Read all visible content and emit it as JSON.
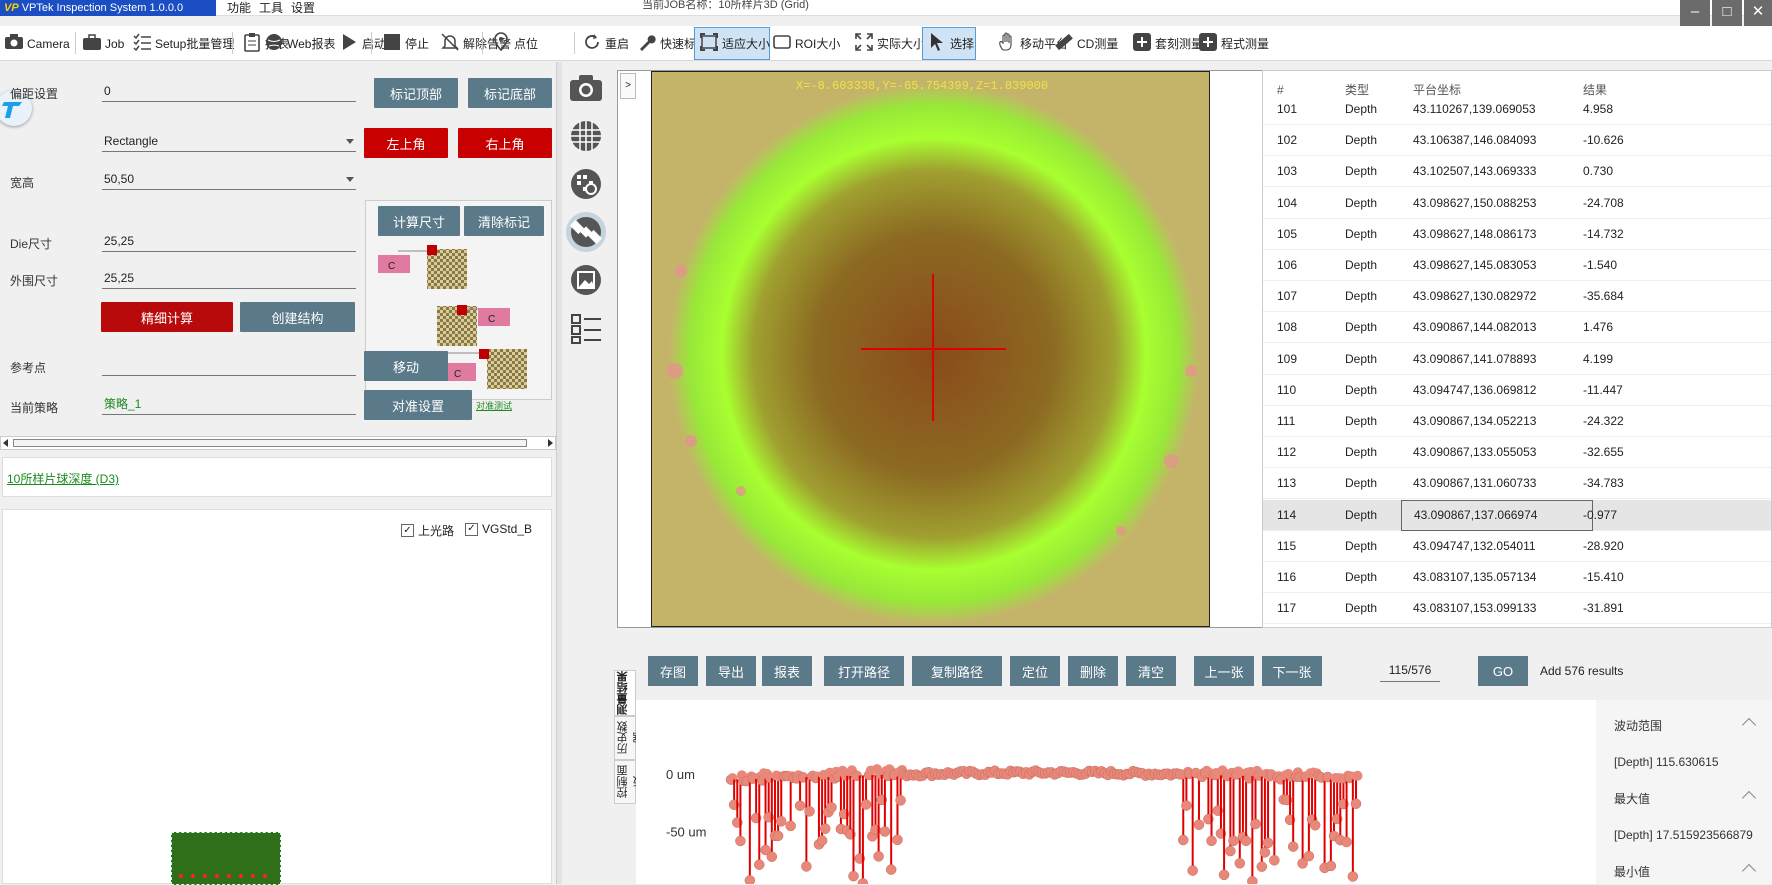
{
  "app": {
    "logo_mark": "VP",
    "name": "VPTek Inspection System 1.0.0.0",
    "menus": [
      "功能",
      "工具",
      "设置"
    ],
    "window_title": "当前JOB名称：10所样片3D (Grid)"
  },
  "toolbar": [
    {
      "label": "Camera",
      "icon": "camera-icon"
    },
    {
      "label": "Job",
      "icon": "briefcase-icon"
    },
    {
      "label": "Setup批量管理",
      "icon": "checklist-icon"
    },
    {
      "label": "报表",
      "icon": "clipboard-icon"
    },
    {
      "label": "Web报表",
      "icon": "web-icon"
    },
    {
      "label": "启动",
      "icon": "play-icon"
    },
    {
      "label": "停止",
      "icon": "stop-icon"
    },
    {
      "label": "解除告警",
      "icon": "bell-off-icon"
    },
    {
      "label": "点位",
      "icon": "location-pin-icon"
    },
    {
      "label": "重启",
      "icon": "restart-icon"
    },
    {
      "label": "快速标定",
      "icon": "wrench-icon"
    },
    {
      "label": "适应大小",
      "icon": "fit-icon",
      "active": true
    },
    {
      "label": "ROI大小",
      "icon": "roi-icon"
    },
    {
      "label": "实际大小",
      "icon": "expand-icon"
    },
    {
      "label": "选择",
      "icon": "cursor-icon",
      "active": true
    },
    {
      "label": "移动平台",
      "icon": "hand-icon"
    },
    {
      "label": "CD测量",
      "icon": "ruler-icon"
    },
    {
      "label": "套刻测量",
      "icon": "plus-box-icon"
    },
    {
      "label": "程式测量",
      "icon": "plus-box-icon"
    }
  ],
  "setup": {
    "offset_label": "偏距设置",
    "offset_value": "0",
    "btn_mark_top": "标记顶部",
    "btn_mark_bottom": "标记底部",
    "shape_value": "Rectangle",
    "btn_top_left": "左上角",
    "btn_top_right": "右上角",
    "wh_label": "宽高",
    "wh_value": "50,50",
    "btn_calc_size": "计算尺寸",
    "btn_clear_marks": "清除标记",
    "die_label": "Die尺寸",
    "die_value": "25,25",
    "outer_label": "外围尺寸",
    "outer_value": "25,25",
    "btn_fine_calc": "精细计算",
    "btn_create_struct": "创建结构",
    "ref_label": "参考点",
    "ref_value": "",
    "btn_move": "移动",
    "strategy_label": "当前策略",
    "strategy_value": "策略_1",
    "btn_align": "对准设置",
    "align_test_link": "对准测试",
    "diagram_chip": "C"
  },
  "job_link": "10所样片球深度 (D3)",
  "checkboxes": [
    {
      "label": "上光路",
      "checked": true
    },
    {
      "label": "VGStd_B",
      "checked": true
    }
  ],
  "image": {
    "coords": "X=-8.603338,Y=-65.754399,Z=1.839000",
    "expand_glyph": ">"
  },
  "table": {
    "headers": [
      "#",
      "类型",
      "平台坐标",
      "结果"
    ],
    "rows": [
      [
        "101",
        "Depth",
        "43.110267,139.069053",
        "4.958"
      ],
      [
        "102",
        "Depth",
        "43.106387,146.084093",
        "-10.626"
      ],
      [
        "103",
        "Depth",
        "43.102507,143.069333",
        "0.730"
      ],
      [
        "104",
        "Depth",
        "43.098627,150.088253",
        "-24.708"
      ],
      [
        "105",
        "Depth",
        "43.098627,148.086173",
        "-14.732"
      ],
      [
        "106",
        "Depth",
        "43.098627,145.083053",
        "-1.540"
      ],
      [
        "107",
        "Depth",
        "43.098627,130.082972",
        "-35.684"
      ],
      [
        "108",
        "Depth",
        "43.090867,144.082013",
        "1.476"
      ],
      [
        "109",
        "Depth",
        "43.090867,141.078893",
        "4.199"
      ],
      [
        "110",
        "Depth",
        "43.094747,136.069812",
        "-11.447"
      ],
      [
        "111",
        "Depth",
        "43.090867,134.052213",
        "-24.322"
      ],
      [
        "112",
        "Depth",
        "43.090867,133.055053",
        "-32.655"
      ],
      [
        "113",
        "Depth",
        "43.090867,131.060733",
        "-34.783"
      ],
      [
        "114",
        "Depth",
        "43.090867,137.066974",
        "-0.977"
      ],
      [
        "115",
        "Depth",
        "43.094747,132.054011",
        "-28.920"
      ],
      [
        "116",
        "Depth",
        "43.083107,135.057134",
        "-15.410"
      ],
      [
        "117",
        "Depth",
        "43.083107,153.099133",
        "-31.891"
      ]
    ],
    "selected_row": "114"
  },
  "results_bar": {
    "buttons": [
      "存图",
      "导出",
      "报表",
      "打开路径",
      "复制路径",
      "定位",
      "删除",
      "清空",
      "上一张",
      "下一张"
    ],
    "page_value": "115/576",
    "go_label": "GO",
    "status": "Add 576 results"
  },
  "tabs": [
    "测量结果",
    "历史数据",
    "控制面板"
  ],
  "stats": {
    "range_label": "波动范围",
    "range_row": "[Depth]   115.630615",
    "max_label": "最大值",
    "max_row": "[Depth]   17.515923566879",
    "min_label": "最小值"
  },
  "chart_data": {
    "type": "scatter",
    "ylabel": "um",
    "ytick_labels": [
      "0 um",
      "-50 um"
    ],
    "series_color": "#e8887a",
    "stem_color": "#e00000",
    "shape": "baseline points near 0 um across the run, rising slightly toward the middle; dense downward stems to around -50..-90 um at both ends"
  }
}
